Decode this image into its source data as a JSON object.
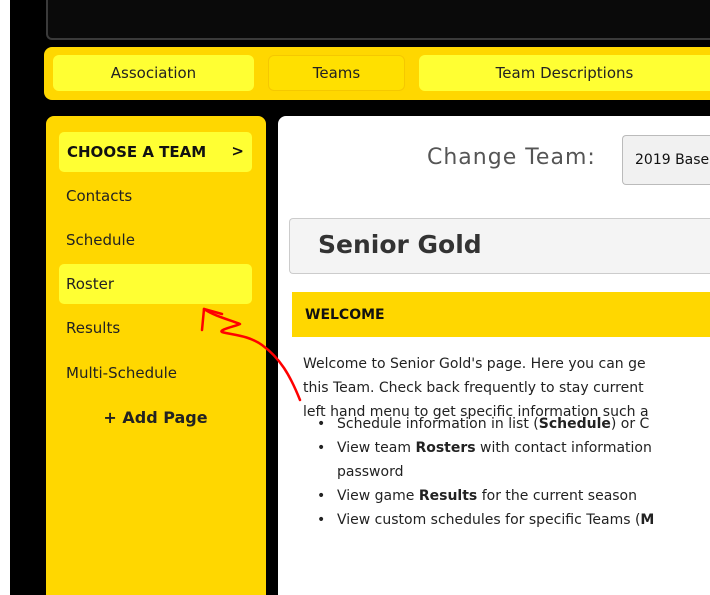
{
  "nav": {
    "tabs": [
      {
        "label": "Association"
      },
      {
        "label": "Teams"
      },
      {
        "label": "Team Descriptions"
      }
    ]
  },
  "sidebar": {
    "choose_label": "CHOOSE A TEAM",
    "chevron": ">",
    "items": [
      {
        "label": "Contacts"
      },
      {
        "label": "Schedule"
      },
      {
        "label": "Roster"
      },
      {
        "label": "Results"
      },
      {
        "label": "Multi-Schedule"
      }
    ],
    "add_page": "+ Add Page"
  },
  "main": {
    "change_team_label": "Change Team:",
    "team_select_value": "2019 Base",
    "team_title": "Senior Gold",
    "welcome_header": "WELCOME",
    "welcome_lines": [
      "Welcome to Senior Gold's page. Here you can ge",
      "this Team. Check back frequently to stay current",
      "left hand menu to get specific information such a"
    ],
    "bullets": {
      "b1_pre": "Schedule information in list (",
      "b1_bold": "Schedule",
      "b1_post": ") or C",
      "b2_pre": "View team ",
      "b2_bold": "Rosters",
      "b2_post": " with contact information",
      "b2_cont": "password",
      "b3_pre": "View game ",
      "b3_bold": "Results",
      "b3_post": " for the current season",
      "b4_pre": "View custom schedules for specific Teams (",
      "b4_bold": "M"
    }
  },
  "annotation": {
    "color": "#ff0000"
  }
}
